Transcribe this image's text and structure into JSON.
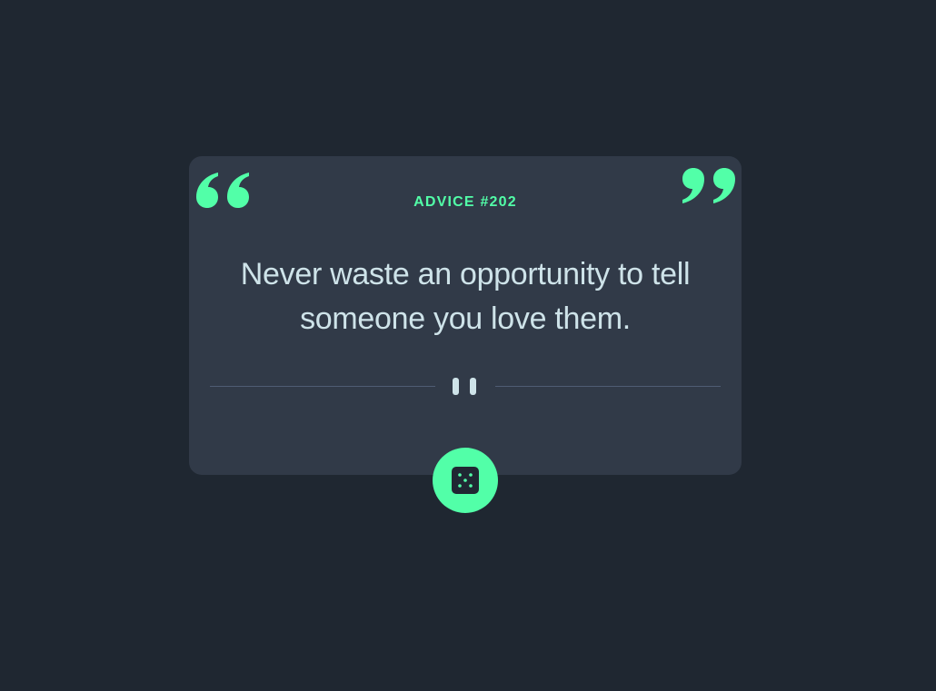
{
  "advice": {
    "label": "ADVICE #202",
    "text": "Never waste an opportunity to tell someone you love them."
  },
  "icons": {
    "open_quote": "open-quote-icon",
    "close_quote": "close-quote-icon",
    "divider": "pause-icon",
    "dice": "dice-icon"
  },
  "colors": {
    "background": "#1f2731",
    "card": "#313a48",
    "accent": "#52ffa8",
    "text": "#cee3e9",
    "divider": "#4f5d74"
  }
}
